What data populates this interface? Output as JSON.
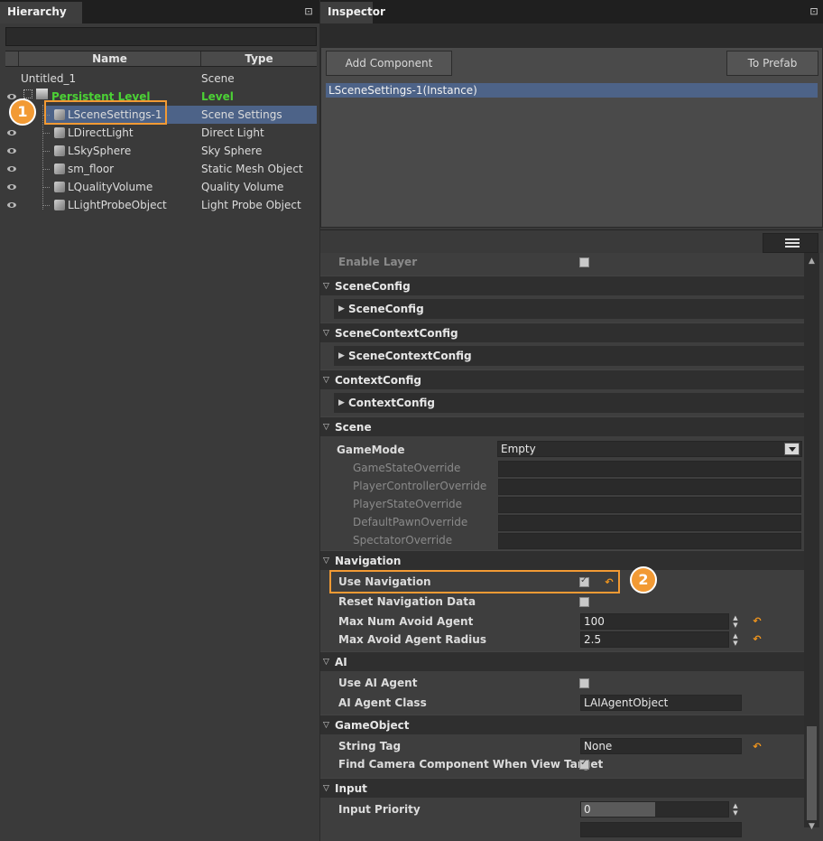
{
  "hierarchy": {
    "tab_label": "Hierarchy",
    "pin_icon": "pin-icon",
    "columns": {
      "name": "Name",
      "type": "Type"
    },
    "rows": [
      {
        "name": "Untitled_1",
        "type": "Scene"
      },
      {
        "name": "Persistent Level",
        "type": "Level"
      },
      {
        "name": "LSceneSettings-1",
        "type": "Scene Settings"
      },
      {
        "name": "LDirectLight",
        "type": "Direct Light"
      },
      {
        "name": "LSkySphere",
        "type": "Sky Sphere"
      },
      {
        "name": "sm_floor",
        "type": "Static Mesh Object"
      },
      {
        "name": "LQualityVolume",
        "type": "Quality Volume"
      },
      {
        "name": "LLightProbeObject",
        "type": "Light Probe Object"
      }
    ]
  },
  "inspector": {
    "tab_label": "Inspector",
    "add_component": "Add Component",
    "to_prefab": "To Prefab",
    "instance": "LSceneSettings-1(Instance)",
    "enable_layer": "Enable Layer",
    "sections": {
      "scene_config": "SceneConfig",
      "scene_config_sub": "SceneConfig",
      "scene_context_config": "SceneContextConfig",
      "scene_context_config_sub": "SceneContextConfig",
      "context_config": "ContextConfig",
      "context_config_sub": "ContextConfig",
      "scene": "Scene",
      "navigation": "Navigation",
      "ai": "AI",
      "gameobject": "GameObject",
      "input": "Input"
    },
    "scene": {
      "gamemode_label": "GameMode",
      "gamemode_value": "Empty",
      "overrides": [
        "GameStateOverride",
        "PlayerControllerOverride",
        "PlayerStateOverride",
        "DefaultPawnOverride",
        "SpectatorOverride"
      ]
    },
    "navigation": {
      "use_navigation": "Use Navigation",
      "reset_navigation": "Reset Navigation Data",
      "max_num_avoid": "Max Num Avoid Agent",
      "max_num_avoid_value": "100",
      "max_radius": "Max Avoid Agent Radius",
      "max_radius_value": "2.5"
    },
    "ai": {
      "use_ai_agent": "Use AI Agent",
      "ai_agent_class": "AI Agent Class",
      "ai_agent_class_value": "LAIAgentObject"
    },
    "gameobject": {
      "string_tag": "String Tag",
      "string_tag_value": "None",
      "find_camera": "Find Camera Component When View Target"
    },
    "input": {
      "input_priority": "Input Priority",
      "input_priority_value": "0",
      "input_priority_fill": 0.5
    }
  },
  "callouts": {
    "first": "1",
    "second": "2"
  },
  "colors": {
    "accent": "#f29a34",
    "selection": "#4d6388",
    "level_green": "#4cd135",
    "reset": "#f2961d"
  }
}
